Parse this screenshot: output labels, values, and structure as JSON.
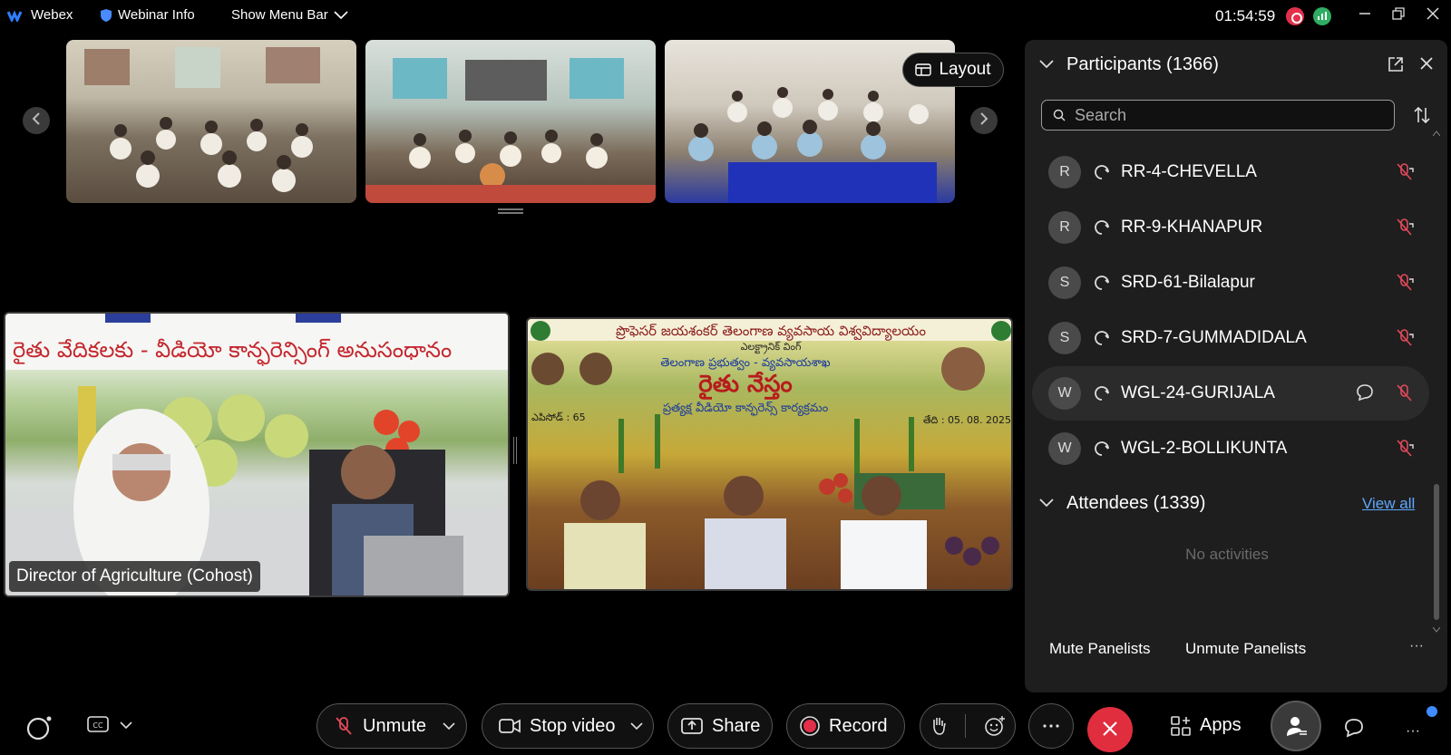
{
  "topbar": {
    "app_name": "Webex",
    "webinar_info": "Webinar Info",
    "show_menu_bar": "Show Menu Bar",
    "timer": "01:54:59"
  },
  "strip": {
    "layout_label": "Layout"
  },
  "main": {
    "left_video_name": "Director of Agriculture (Cohost)",
    "right_video": {
      "banner_top": "ప్రొఫెసర్ జయశంకర్ తెలంగాణ వ్యవసాయ విశ్వవిద్యాలయం",
      "banner_sub": "ఎలక్ట్రానిక్ వింగ్",
      "govt_line": "తెలంగాణ ప్రభుత్వం - వ్యవసాయశాఖ",
      "program_title": "రైతు నేస్తం",
      "program_sub": "ప్రత్యక్ష వీడియో కాన్ఫరెన్స్ కార్యక్రమం",
      "episode": "ఎపిసోడ్ : 65",
      "date": "తేది : 05. 08. 2025"
    },
    "left_banner_text": "రైతు వేదికలకు - వీడియో కాన్ఫరెన్సింగ్ అనుసంధానం"
  },
  "panel": {
    "title": "Participants (1366)",
    "search_placeholder": "Search",
    "participants": [
      {
        "initial": "R",
        "name": "RR-4-CHEVELLA"
      },
      {
        "initial": "R",
        "name": "RR-9-KHANAPUR"
      },
      {
        "initial": "S",
        "name": "SRD-61-Bilalapur"
      },
      {
        "initial": "S",
        "name": "SRD-7-GUMMADIDALA"
      },
      {
        "initial": "W",
        "name": "WGL-24-GURIJALA"
      },
      {
        "initial": "W",
        "name": "WGL-2-BOLLIKUNTA"
      }
    ],
    "attendees_title": "Attendees (1339)",
    "view_all": "View all",
    "no_activities": "No activities",
    "mute_panelists": "Mute Panelists",
    "unmute_panelists": "Unmute Panelists"
  },
  "toolbar": {
    "unmute": "Unmute",
    "stop_video": "Stop video",
    "share": "Share",
    "record": "Record",
    "apps": "Apps"
  },
  "colors": {
    "end_call": "#e02e3f",
    "link": "#5fa8ff",
    "record_dot": "#e3304a"
  }
}
